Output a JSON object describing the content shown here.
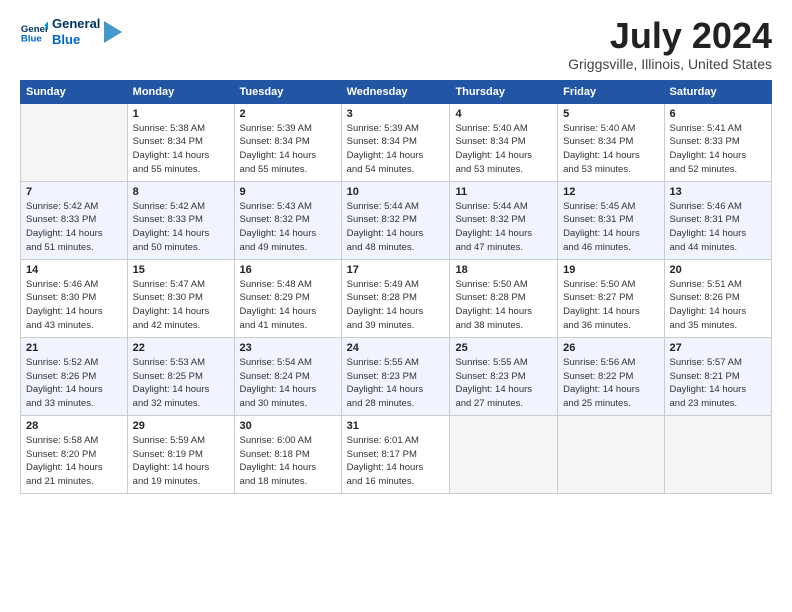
{
  "logo": {
    "line1": "General",
    "line2": "Blue"
  },
  "title": "July 2024",
  "location": "Griggsville, Illinois, United States",
  "days_of_week": [
    "Sunday",
    "Monday",
    "Tuesday",
    "Wednesday",
    "Thursday",
    "Friday",
    "Saturday"
  ],
  "weeks": [
    [
      {
        "day": "",
        "info": ""
      },
      {
        "day": "1",
        "info": "Sunrise: 5:38 AM\nSunset: 8:34 PM\nDaylight: 14 hours\nand 55 minutes."
      },
      {
        "day": "2",
        "info": "Sunrise: 5:39 AM\nSunset: 8:34 PM\nDaylight: 14 hours\nand 55 minutes."
      },
      {
        "day": "3",
        "info": "Sunrise: 5:39 AM\nSunset: 8:34 PM\nDaylight: 14 hours\nand 54 minutes."
      },
      {
        "day": "4",
        "info": "Sunrise: 5:40 AM\nSunset: 8:34 PM\nDaylight: 14 hours\nand 53 minutes."
      },
      {
        "day": "5",
        "info": "Sunrise: 5:40 AM\nSunset: 8:34 PM\nDaylight: 14 hours\nand 53 minutes."
      },
      {
        "day": "6",
        "info": "Sunrise: 5:41 AM\nSunset: 8:33 PM\nDaylight: 14 hours\nand 52 minutes."
      }
    ],
    [
      {
        "day": "7",
        "info": "Sunrise: 5:42 AM\nSunset: 8:33 PM\nDaylight: 14 hours\nand 51 minutes."
      },
      {
        "day": "8",
        "info": "Sunrise: 5:42 AM\nSunset: 8:33 PM\nDaylight: 14 hours\nand 50 minutes."
      },
      {
        "day": "9",
        "info": "Sunrise: 5:43 AM\nSunset: 8:32 PM\nDaylight: 14 hours\nand 49 minutes."
      },
      {
        "day": "10",
        "info": "Sunrise: 5:44 AM\nSunset: 8:32 PM\nDaylight: 14 hours\nand 48 minutes."
      },
      {
        "day": "11",
        "info": "Sunrise: 5:44 AM\nSunset: 8:32 PM\nDaylight: 14 hours\nand 47 minutes."
      },
      {
        "day": "12",
        "info": "Sunrise: 5:45 AM\nSunset: 8:31 PM\nDaylight: 14 hours\nand 46 minutes."
      },
      {
        "day": "13",
        "info": "Sunrise: 5:46 AM\nSunset: 8:31 PM\nDaylight: 14 hours\nand 44 minutes."
      }
    ],
    [
      {
        "day": "14",
        "info": "Sunrise: 5:46 AM\nSunset: 8:30 PM\nDaylight: 14 hours\nand 43 minutes."
      },
      {
        "day": "15",
        "info": "Sunrise: 5:47 AM\nSunset: 8:30 PM\nDaylight: 14 hours\nand 42 minutes."
      },
      {
        "day": "16",
        "info": "Sunrise: 5:48 AM\nSunset: 8:29 PM\nDaylight: 14 hours\nand 41 minutes."
      },
      {
        "day": "17",
        "info": "Sunrise: 5:49 AM\nSunset: 8:28 PM\nDaylight: 14 hours\nand 39 minutes."
      },
      {
        "day": "18",
        "info": "Sunrise: 5:50 AM\nSunset: 8:28 PM\nDaylight: 14 hours\nand 38 minutes."
      },
      {
        "day": "19",
        "info": "Sunrise: 5:50 AM\nSunset: 8:27 PM\nDaylight: 14 hours\nand 36 minutes."
      },
      {
        "day": "20",
        "info": "Sunrise: 5:51 AM\nSunset: 8:26 PM\nDaylight: 14 hours\nand 35 minutes."
      }
    ],
    [
      {
        "day": "21",
        "info": "Sunrise: 5:52 AM\nSunset: 8:26 PM\nDaylight: 14 hours\nand 33 minutes."
      },
      {
        "day": "22",
        "info": "Sunrise: 5:53 AM\nSunset: 8:25 PM\nDaylight: 14 hours\nand 32 minutes."
      },
      {
        "day": "23",
        "info": "Sunrise: 5:54 AM\nSunset: 8:24 PM\nDaylight: 14 hours\nand 30 minutes."
      },
      {
        "day": "24",
        "info": "Sunrise: 5:55 AM\nSunset: 8:23 PM\nDaylight: 14 hours\nand 28 minutes."
      },
      {
        "day": "25",
        "info": "Sunrise: 5:55 AM\nSunset: 8:23 PM\nDaylight: 14 hours\nand 27 minutes."
      },
      {
        "day": "26",
        "info": "Sunrise: 5:56 AM\nSunset: 8:22 PM\nDaylight: 14 hours\nand 25 minutes."
      },
      {
        "day": "27",
        "info": "Sunrise: 5:57 AM\nSunset: 8:21 PM\nDaylight: 14 hours\nand 23 minutes."
      }
    ],
    [
      {
        "day": "28",
        "info": "Sunrise: 5:58 AM\nSunset: 8:20 PM\nDaylight: 14 hours\nand 21 minutes."
      },
      {
        "day": "29",
        "info": "Sunrise: 5:59 AM\nSunset: 8:19 PM\nDaylight: 14 hours\nand 19 minutes."
      },
      {
        "day": "30",
        "info": "Sunrise: 6:00 AM\nSunset: 8:18 PM\nDaylight: 14 hours\nand 18 minutes."
      },
      {
        "day": "31",
        "info": "Sunrise: 6:01 AM\nSunset: 8:17 PM\nDaylight: 14 hours\nand 16 minutes."
      },
      {
        "day": "",
        "info": ""
      },
      {
        "day": "",
        "info": ""
      },
      {
        "day": "",
        "info": ""
      }
    ]
  ]
}
